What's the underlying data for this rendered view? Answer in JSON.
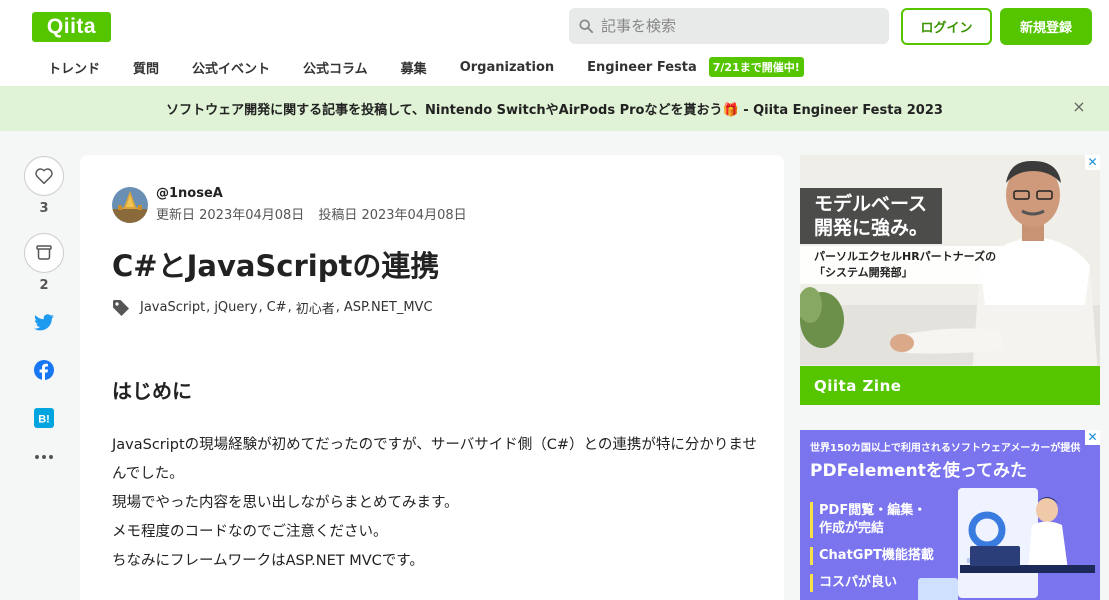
{
  "header": {
    "logo": "Qiita",
    "search_placeholder": "記事を検索",
    "login": "ログイン",
    "signup": "新規登録"
  },
  "nav": {
    "items": [
      "トレンド",
      "質問",
      "公式イベント",
      "公式コラム",
      "募集",
      "Organization",
      "Engineer Festa"
    ],
    "badge": "7/21まで開催中!"
  },
  "banner": {
    "text_before": "ソフトウェア開発に関する記事を投稿して、Nintendo SwitchやAirPods Proなどを貰おう",
    "emoji": "🎁",
    "text_after": " - Qiita Engineer Festa 2023",
    "close": "×"
  },
  "actions": {
    "like_count": "3",
    "stock_count": "2"
  },
  "article": {
    "author": "@1noseA",
    "updated": "更新日 2023年04月08日",
    "posted": "投稿日 2023年04月08日",
    "title": "C#とJavaScriptの連携",
    "tags": [
      "JavaScript",
      "jQuery",
      "C#",
      "初心者",
      "ASP.NET_MVC"
    ],
    "section_heading": "はじめに",
    "paragraphs": [
      "JavaScriptの現場経験が初めてだったのですが、サーバサイド側（C#）との連携が特に分かりませんでした。",
      "現場でやった内容を思い出しながらまとめてみます。",
      "メモ程度のコードなのでご注意ください。",
      "ちなみにフレームワークはASP.NET MVCです。"
    ]
  },
  "ads": {
    "ad1": {
      "headline_1": "モデルベース",
      "headline_2": "開発に強み。",
      "sub_1": "パーソルエクセルHRパートナーズの",
      "sub_2": "「システム開発部」",
      "footer": "Qiita Zine",
      "close": "✕"
    },
    "ad2": {
      "top": "世界150カ国以上で利用されるソフトウェアメーカーが提供",
      "title": "PDFelementを使ってみた",
      "items": [
        "PDF閲覧・編集・作成が完結",
        "ChatGPT機能搭載",
        "コスパが良い"
      ],
      "close": "✕"
    }
  }
}
